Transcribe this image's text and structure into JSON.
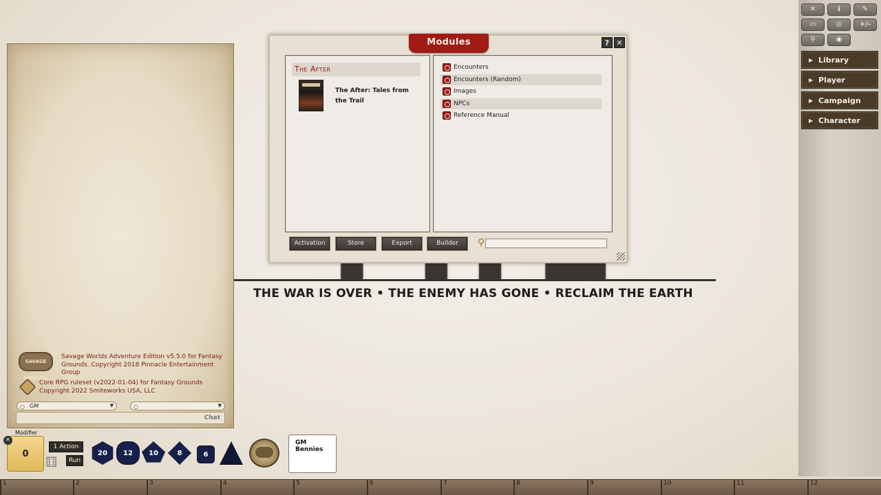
{
  "background": {
    "splash_title": "THE AFTER",
    "tagline": "THE WAR IS OVER • THE ENEMY HAS GONE • RECLAIM THE EARTH"
  },
  "chat": {
    "credits": [
      {
        "text": "Savage Worlds Adventure Edition v5.5.0 for Fantasy Grounds. Copyright 2018 Pinnacle Entertainment Group",
        "logo": "SAVAGE WORLDS"
      },
      {
        "text": "Core RPG ruleset (v2022-01-04) for Fantasy Grounds Copyright 2022 Smiteworks USA, LLC"
      }
    ],
    "identity_select": "GM",
    "mode_select": "",
    "chat_label": "Chat"
  },
  "modules_window": {
    "title": "Modules",
    "help_label": "?",
    "close_label": "✕",
    "group": "The After",
    "module_name": "The After: Tales from the Trail",
    "entries": [
      "Encounters",
      "Encounters (Random)",
      "Images",
      "NPCs",
      "Reference Manual"
    ],
    "buttons": [
      "Activation",
      "Store",
      "Export",
      "Builder"
    ],
    "search_value": ""
  },
  "sidebar": {
    "tools": [
      "✕",
      "ℹ",
      "✎",
      "▭",
      "◎",
      "+/-",
      "⚲",
      "◉"
    ],
    "buttons": [
      "Library",
      "Player",
      "Campaign",
      "Character"
    ]
  },
  "hotbar": {
    "slots": [
      "1",
      "2",
      "3",
      "4",
      "5",
      "6",
      "7",
      "8",
      "9",
      "10",
      "11",
      "12"
    ]
  },
  "dice_tray": {
    "modifier_label": "Modifier",
    "modifier_value": "0",
    "action_label": "1 Action",
    "run_label": "Run",
    "dice": [
      "20",
      "12",
      "10",
      "8",
      "6",
      ""
    ],
    "gm_bennies_label": "GM Bennies"
  },
  "colors": {
    "accent_red": "#a11a14",
    "sidebar_button": "#4a3a28"
  }
}
